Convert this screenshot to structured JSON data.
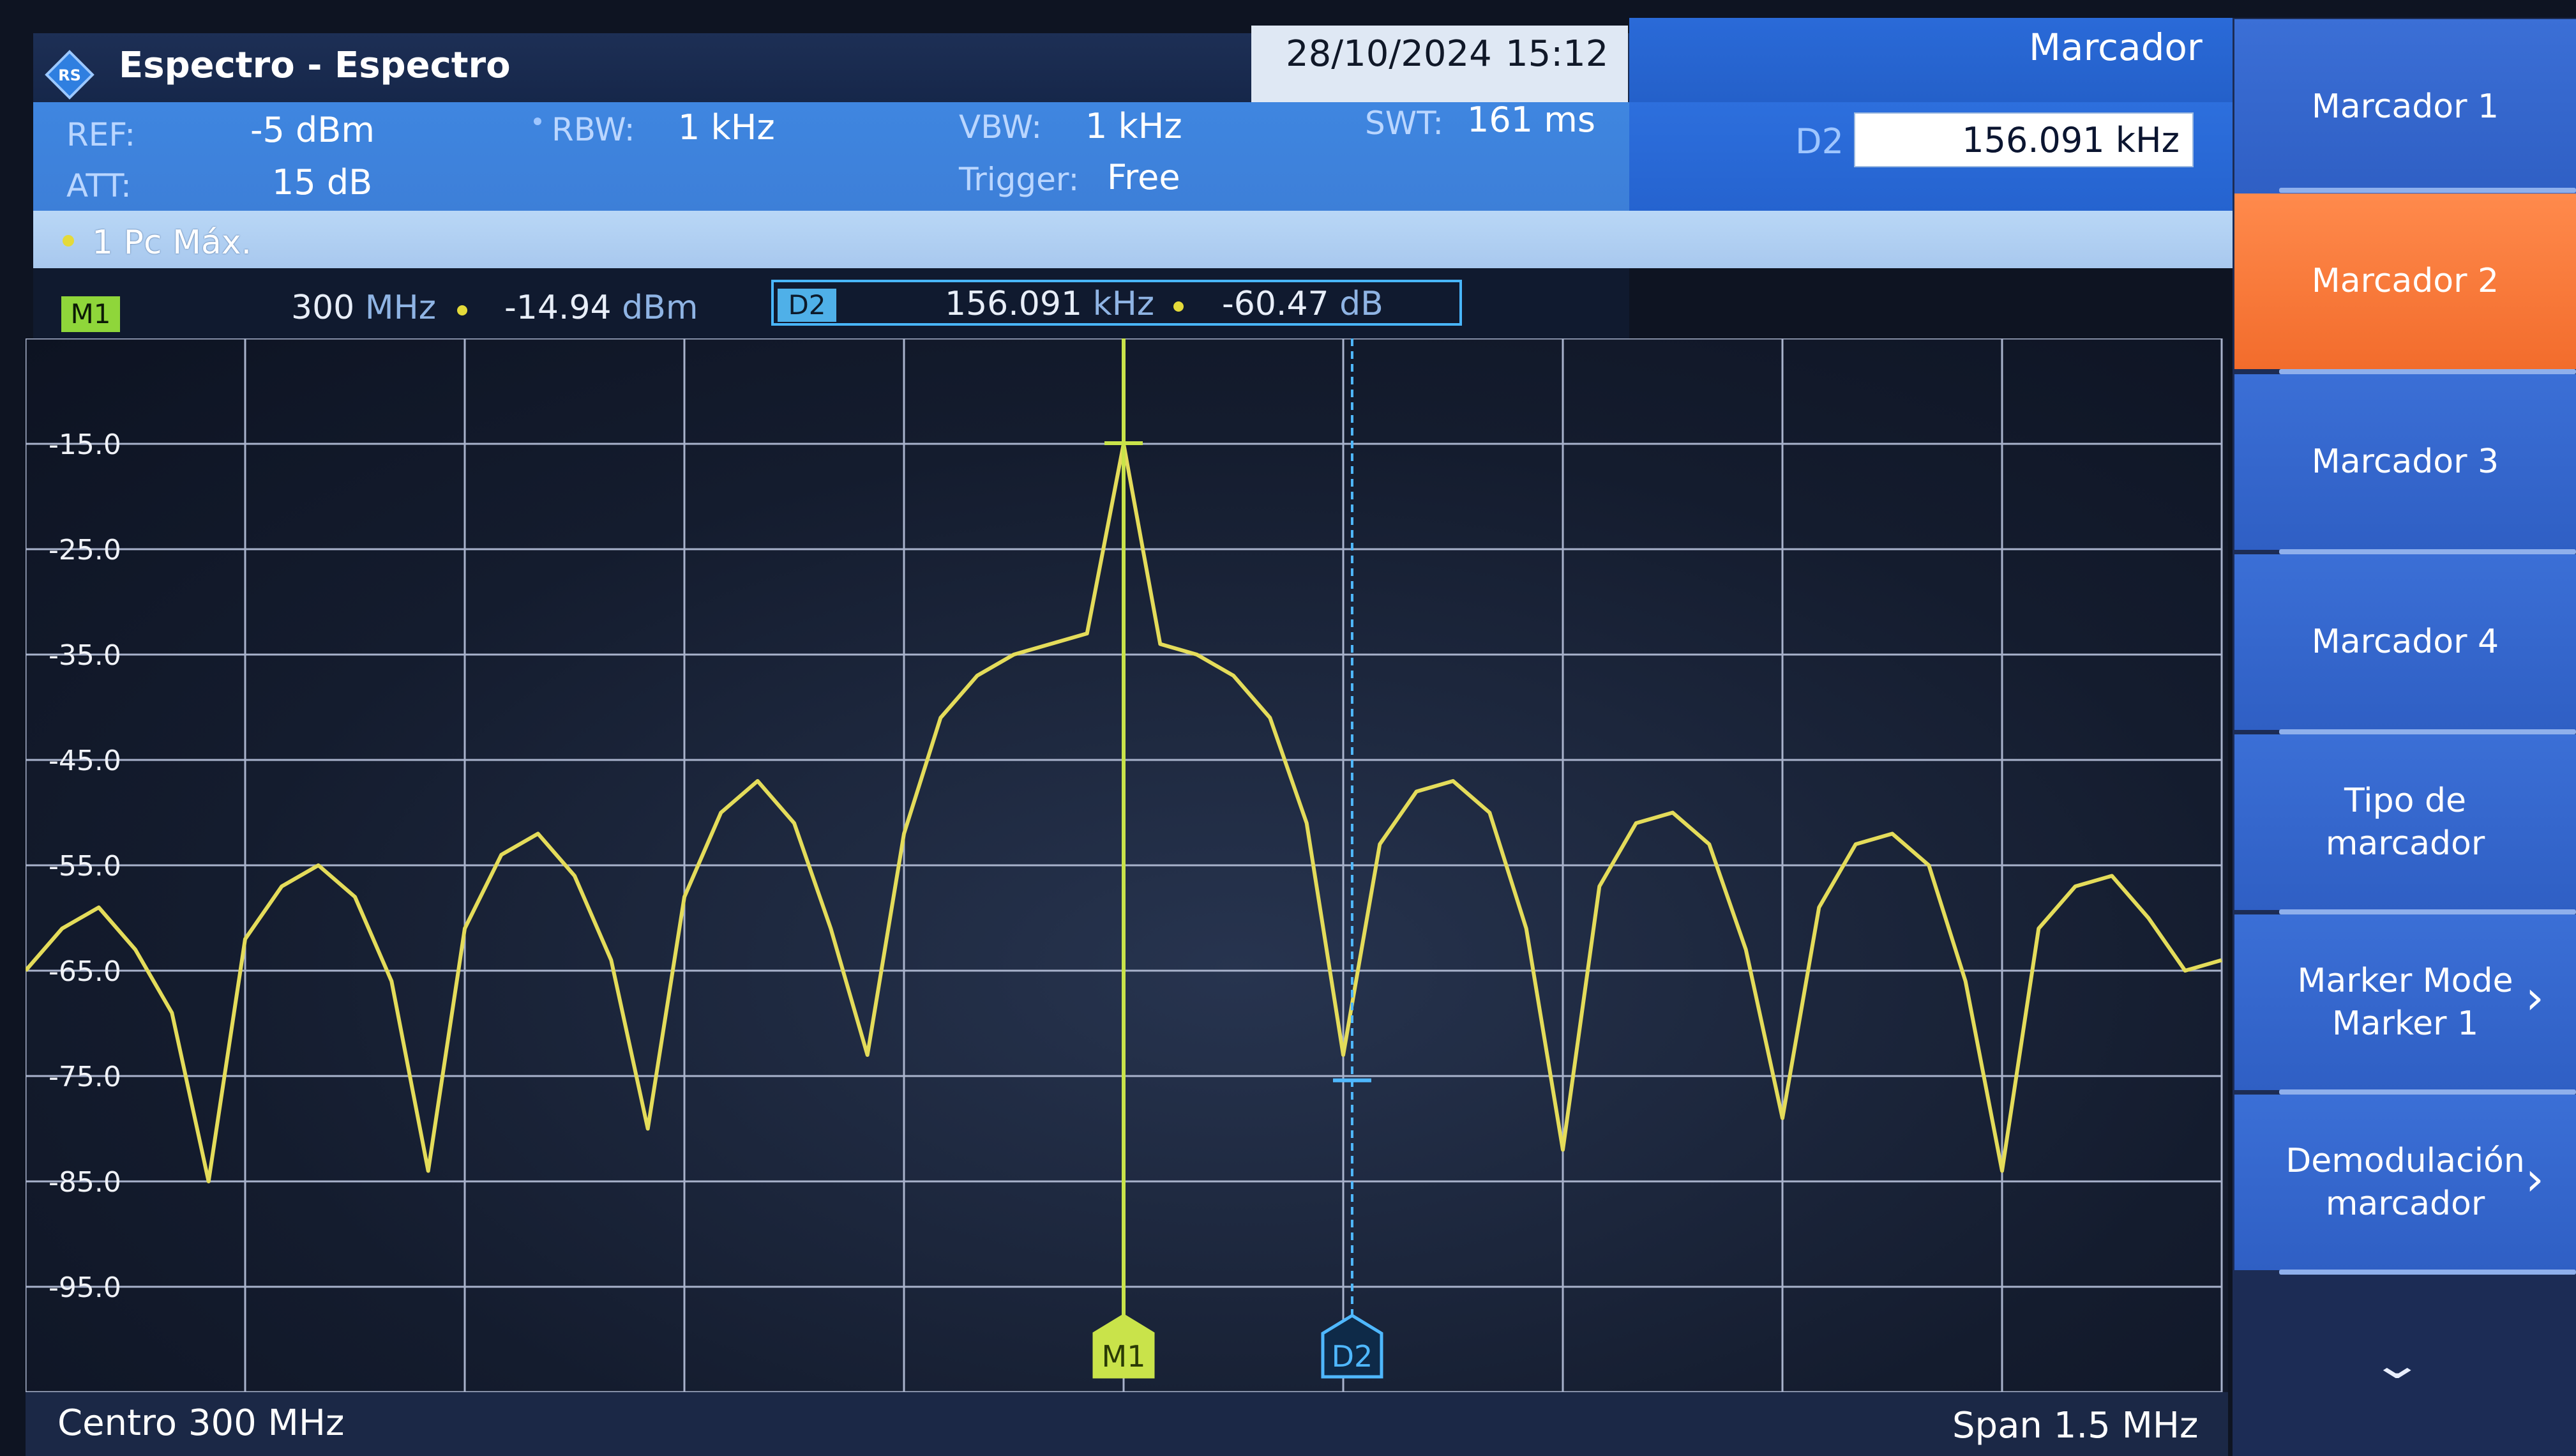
{
  "header": {
    "title": "Espectro - Espectro",
    "date": "28/10/2024",
    "time": "15:12",
    "panel_title": "Marcador"
  },
  "params": {
    "ref_label": "REF:",
    "ref_value": "-5 dBm",
    "att_label": "ATT:",
    "att_value": "15 dB",
    "rbw_label": "RBW:",
    "rbw_value": "1 kHz",
    "vbw_label": "VBW:",
    "vbw_value": "1 kHz",
    "trigger_label": "Trigger:",
    "trigger_value": "Free",
    "swt_label": "SWT:",
    "swt_value": "161 ms"
  },
  "d2_entry": {
    "label": "D2",
    "value": "156.091 kHz"
  },
  "trace": {
    "label": "1 Pc  Máx."
  },
  "markers": {
    "m1": {
      "badge": "M1",
      "freq": "300",
      "freq_unit": "MHz",
      "level": "-14.94",
      "level_unit": "dBm"
    },
    "d2": {
      "badge": "D2",
      "freq": "156.091",
      "freq_unit": "kHz",
      "level": "-60.47",
      "level_unit": "dB"
    }
  },
  "footer": {
    "center": "Centro 300 MHz",
    "span": "Span 1.5 MHz"
  },
  "menu": {
    "items": [
      {
        "label": "Marcador 1"
      },
      {
        "label": "Marcador 2",
        "active": true
      },
      {
        "label": "Marcador 3"
      },
      {
        "label": "Marcador 4"
      },
      {
        "label_line1": "Tipo de",
        "label_line2": "marcador"
      },
      {
        "label_line1": "Marker Mode",
        "label_line2": "Marker 1"
      },
      {
        "label_line1": "Demodulación",
        "label_line2": "marcador"
      }
    ]
  },
  "colors": {
    "trace": "#e4dc5a",
    "marker_m1": "#c9e34a",
    "marker_d2": "#4fb8ff",
    "grid": "#a9b3cc",
    "active_menu": "#f57a36",
    "menu_item": "#3568d0"
  },
  "chart_data": {
    "type": "line",
    "x_label": "",
    "y_label": "",
    "y_ticks": [
      "-15.0",
      "-25.0",
      "-35.0",
      "-45.0",
      "-55.0",
      "-65.0",
      "-75.0",
      "-85.0",
      "-95.0"
    ],
    "x_range_mhz": [
      299.25,
      300.75
    ],
    "y_range_dbm": [
      -5,
      -105
    ],
    "grid": true,
    "series": [
      {
        "x_mhz": [
          299.25,
          299.275,
          299.3,
          299.325,
          299.35,
          299.375,
          299.4,
          299.425,
          299.45,
          299.475,
          299.5,
          299.525,
          299.55,
          299.575,
          299.6,
          299.625,
          299.65,
          299.675,
          299.7,
          299.725,
          299.75,
          299.775,
          299.8,
          299.825,
          299.85,
          299.875,
          299.9,
          299.925,
          299.95,
          299.975,
          300.0,
          300.025,
          300.05,
          300.075,
          300.1,
          300.125,
          300.15,
          300.175,
          300.2,
          300.225,
          300.25,
          300.275,
          300.3,
          300.325,
          300.35,
          300.375,
          300.4,
          300.425,
          300.45,
          300.475,
          300.5,
          300.525,
          300.55,
          300.575,
          300.6,
          300.625,
          300.65,
          300.675,
          300.7,
          300.725,
          300.75
        ],
        "y_dbm": [
          -65,
          -61,
          -59,
          -63,
          -69,
          -85,
          -62,
          -57,
          -55,
          -58,
          -66,
          -84,
          -61,
          -54,
          -52,
          -56,
          -64,
          -80,
          -58,
          -50,
          -47,
          -51,
          -61,
          -73,
          -52,
          -41,
          -37,
          -35,
          -34,
          -33,
          -15,
          -34,
          -35,
          -37,
          -41,
          -51,
          -73,
          -53,
          -48,
          -47,
          -50,
          -61,
          -82,
          -57,
          -51,
          -50,
          -53,
          -63,
          -79,
          -59,
          -53,
          -52,
          -55,
          -66,
          -84,
          -61,
          -57,
          -56,
          -60,
          -65,
          -64
        ]
      }
    ],
    "markers": [
      {
        "name": "M1",
        "x_mhz": 300.0,
        "y_dbm": -14.94
      },
      {
        "name": "D2",
        "x_mhz": 300.156091,
        "y_dbm": -75.41
      }
    ]
  }
}
